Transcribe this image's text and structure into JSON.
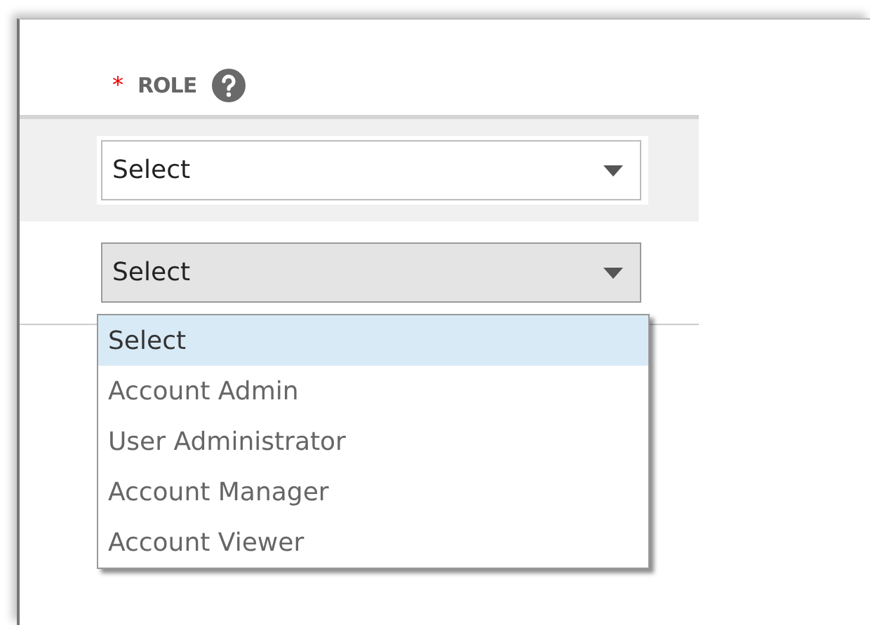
{
  "field": {
    "required_mark": "*",
    "label": "ROLE"
  },
  "rows": [
    {
      "value": "Select",
      "open": false
    },
    {
      "value": "Select",
      "open": true
    }
  ],
  "options": [
    {
      "label": "Select",
      "selected": true
    },
    {
      "label": "Account Admin",
      "selected": false
    },
    {
      "label": "User Administrator",
      "selected": false
    },
    {
      "label": "Account Manager",
      "selected": false
    },
    {
      "label": "Account Viewer",
      "selected": false
    }
  ]
}
